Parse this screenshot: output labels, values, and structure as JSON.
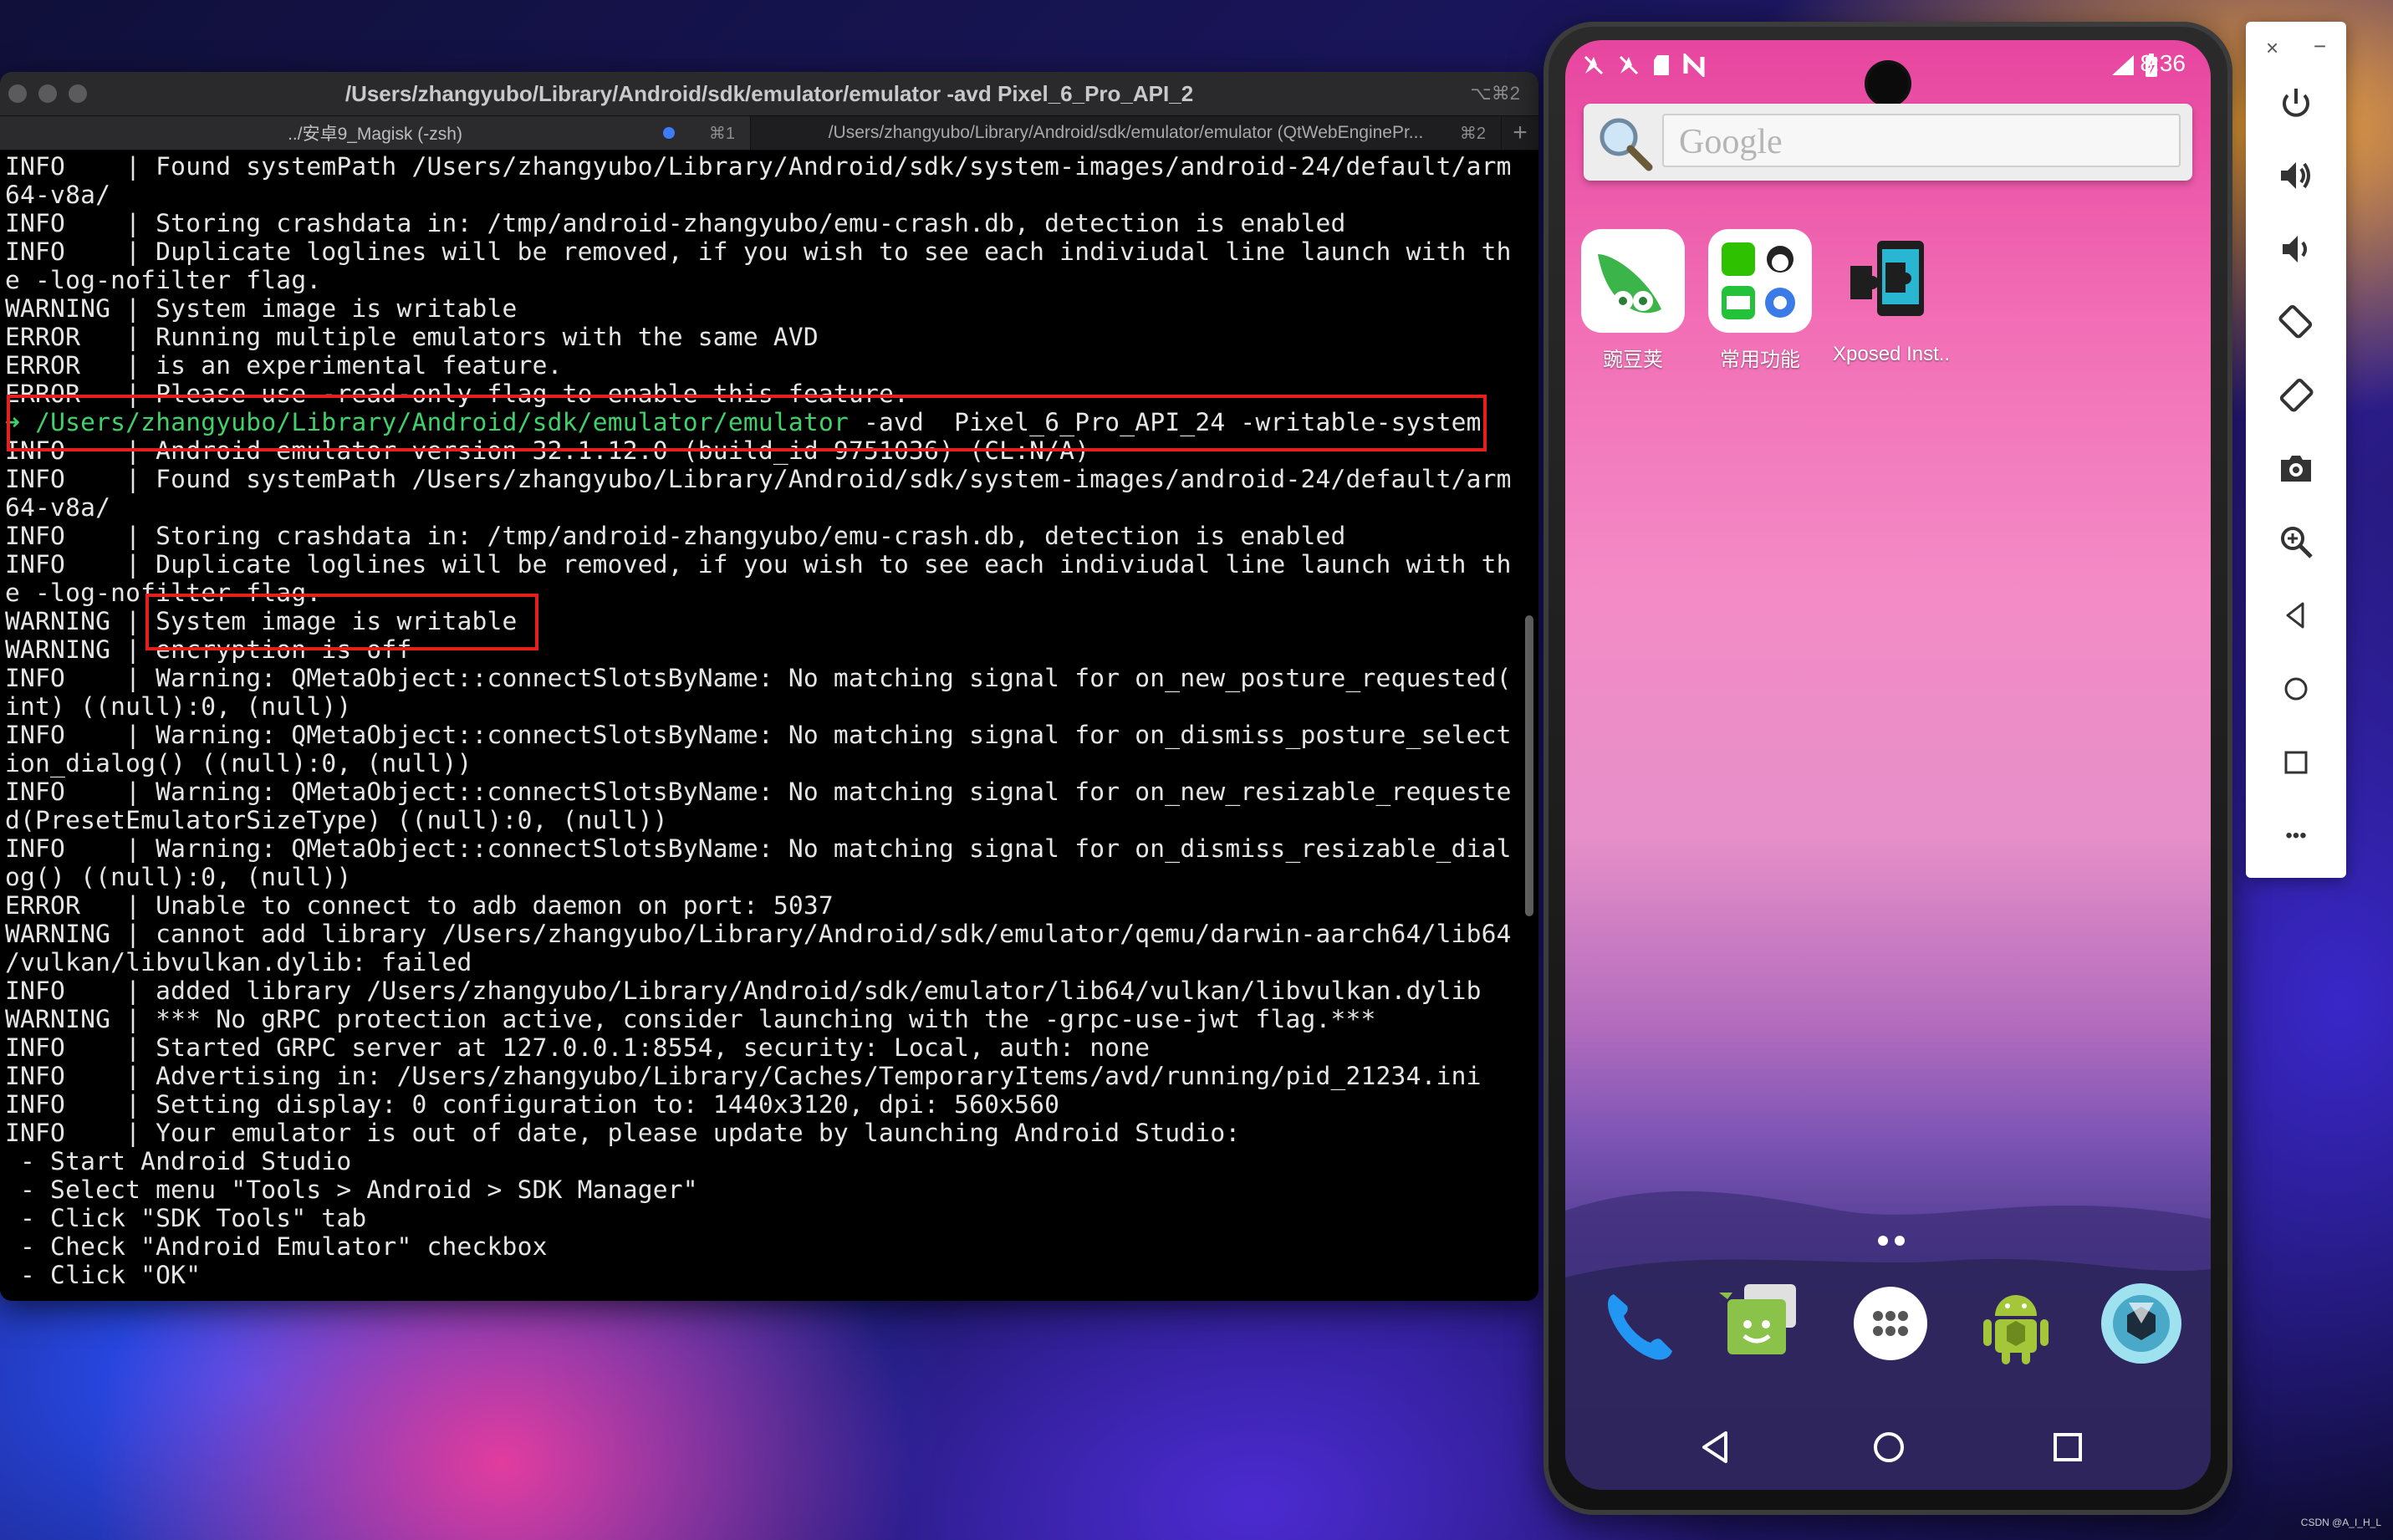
{
  "terminal": {
    "title": "/Users/zhangyubo/Library/Android/sdk/emulator/emulator -avd Pixel_6_Pro_API_2",
    "title_shortcut": "⌥⌘2",
    "tabs": [
      {
        "label": "../安卓9_Magisk (-zsh)",
        "shortcut": "⌘1"
      },
      {
        "label": "/Users/zhangyubo/Library/Android/sdk/emulator/emulator (QtWebEnginePr...",
        "shortcut": "⌘2"
      }
    ],
    "new_tab": "+",
    "lines": [
      "INFO    | Found systemPath /Users/zhangyubo/Library/Android/sdk/system-images/android-24/default/arm",
      "64-v8a/",
      "INFO    | Storing crashdata in: /tmp/android-zhangyubo/emu-crash.db, detection is enabled",
      "INFO    | Duplicate loglines will be removed, if you wish to see each indiviudal line launch with th",
      "e -log-nofilter flag.",
      "WARNING | System image is writable",
      "ERROR   | Running multiple emulators with the same AVD",
      "ERROR   | is an experimental feature.",
      "ERROR   | Please use -read-only flag to enable this feature.",
      "",
      "INFO    | Android emulator version 32.1.12.0 (build_id 9751036) (CL:N/A)",
      "INFO    | Found systemPath /Users/zhangyubo/Library/Android/sdk/system-images/android-24/default/arm",
      "64-v8a/",
      "INFO    | Storing crashdata in: /tmp/android-zhangyubo/emu-crash.db, detection is enabled",
      "INFO    | Duplicate loglines will be removed, if you wish to see each indiviudal line launch with th",
      "e -log-nofilter flag.",
      "WARNING | System image is writable",
      "WARNING | encryption is off",
      "INFO    | Warning: QMetaObject::connectSlotsByName: No matching signal for on_new_posture_requested(",
      "int) ((null):0, (null))",
      "INFO    | Warning: QMetaObject::connectSlotsByName: No matching signal for on_dismiss_posture_select",
      "ion_dialog() ((null):0, (null))",
      "INFO    | Warning: QMetaObject::connectSlotsByName: No matching signal for on_new_resizable_requeste",
      "d(PresetEmulatorSizeType) ((null):0, (null))",
      "INFO    | Warning: QMetaObject::connectSlotsByName: No matching signal for on_dismiss_resizable_dial",
      "og() ((null):0, (null))",
      "ERROR   | Unable to connect to adb daemon on port: 5037",
      "WARNING | cannot add library /Users/zhangyubo/Library/Android/sdk/emulator/qemu/darwin-aarch64/lib64",
      "/vulkan/libvulkan.dylib: failed",
      "INFO    | added library /Users/zhangyubo/Library/Android/sdk/emulator/lib64/vulkan/libvulkan.dylib",
      "WARNING | *** No gRPC protection active, consider launching with the -grpc-use-jwt flag.***",
      "INFO    | Started GRPC server at 127.0.0.1:8554, security: Local, auth: none",
      "INFO    | Advertising in: /Users/zhangyubo/Library/Caches/TemporaryItems/avd/running/pid_21234.ini",
      "INFO    | Setting display: 0 configuration to: 1440x3120, dpi: 560x560",
      "INFO    | Your emulator is out of date, please update by launching Android Studio:",
      " - Start Android Studio",
      " - Select menu \"Tools > Android > SDK Manager\"",
      " - Click \"SDK Tools\" tab",
      " - Check \"Android Emulator\" checkbox",
      " - Click \"OK\""
    ],
    "command_line": {
      "prompt": "➜",
      "path": "/Users/zhangyubo/Library/Android/sdk/emulator/emulator",
      "args": " -avd  Pixel_6_Pro_API_24 -writable-system"
    },
    "prompt_color": "#3fd16a",
    "highlight_color": "#e61e1e"
  },
  "phone": {
    "time": "8:36",
    "search_placeholder": "Google",
    "apps": [
      {
        "label": "豌豆荚",
        "icon": "wandoujia-icon"
      },
      {
        "label": "常用功能",
        "icon": "folder-icon"
      },
      {
        "label": "Xposed Inst..",
        "icon": "xposed-icon"
      }
    ],
    "dock": [
      "phone-icon",
      "messaging-icon",
      "all-apps-icon",
      "android-icon",
      "camera-icon"
    ]
  },
  "controls": {
    "close": "×",
    "minimize": "−",
    "more": "•••"
  },
  "watermark": "CSDN @A_I_H_L"
}
